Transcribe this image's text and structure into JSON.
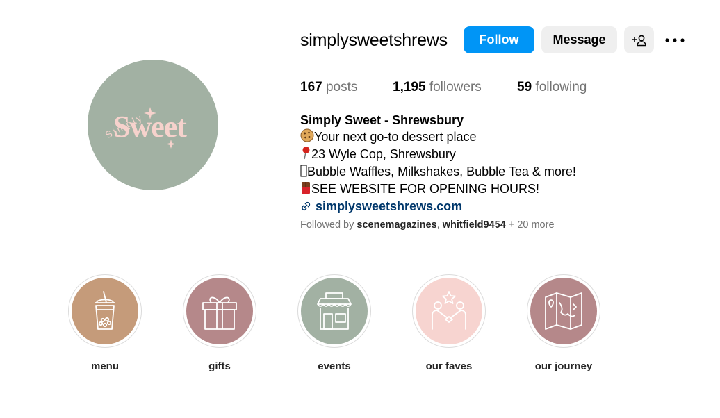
{
  "profile": {
    "username": "simplysweetshrews",
    "avatar_text": {
      "top": "Simply",
      "main": "Sweet"
    },
    "follow_label": "Follow",
    "message_label": "Message",
    "add_user_icon": "add-person-icon",
    "more_icon": "more-horizontal-icon"
  },
  "stats": {
    "posts_count": "167",
    "posts_label": "posts",
    "followers_count": "1,195",
    "followers_label": "followers",
    "following_count": "59",
    "following_label": "following"
  },
  "bio": {
    "name": "Simply Sweet - Shrewsbury",
    "line1": "Your next go-to dessert place",
    "line2": "23 Wyle Cop, Shrewsbury",
    "line3": "Bubble Waffles, Milkshakes, Bubble Tea & more!",
    "line4": "SEE WEBSITE FOR OPENING HOURS!",
    "link": "simplysweetshrews.com"
  },
  "followed_by": {
    "prefix": "Followed by",
    "user1": "scenemagazines",
    "separator": ",",
    "user2": "whitfield9454",
    "suffix": "+ 20 more"
  },
  "highlights": [
    {
      "label": "menu",
      "color": "#c59b7a",
      "icon": "bubble-tea-icon"
    },
    {
      "label": "gifts",
      "color": "#b5888a",
      "icon": "gift-icon"
    },
    {
      "label": "events",
      "color": "#a2b1a3",
      "icon": "shop-icon"
    },
    {
      "label": "our faves",
      "color": "#f7d4d0",
      "icon": "handshake-star-icon"
    },
    {
      "label": "our journey",
      "color": "#b5888a",
      "icon": "map-icon"
    }
  ],
  "colors": {
    "primary_button": "#0095f6",
    "secondary_button": "#efefef",
    "link": "#00376b",
    "muted_text": "#737373",
    "avatar_bg": "#a2b1a3",
    "avatar_text": "#f6d2cc"
  }
}
